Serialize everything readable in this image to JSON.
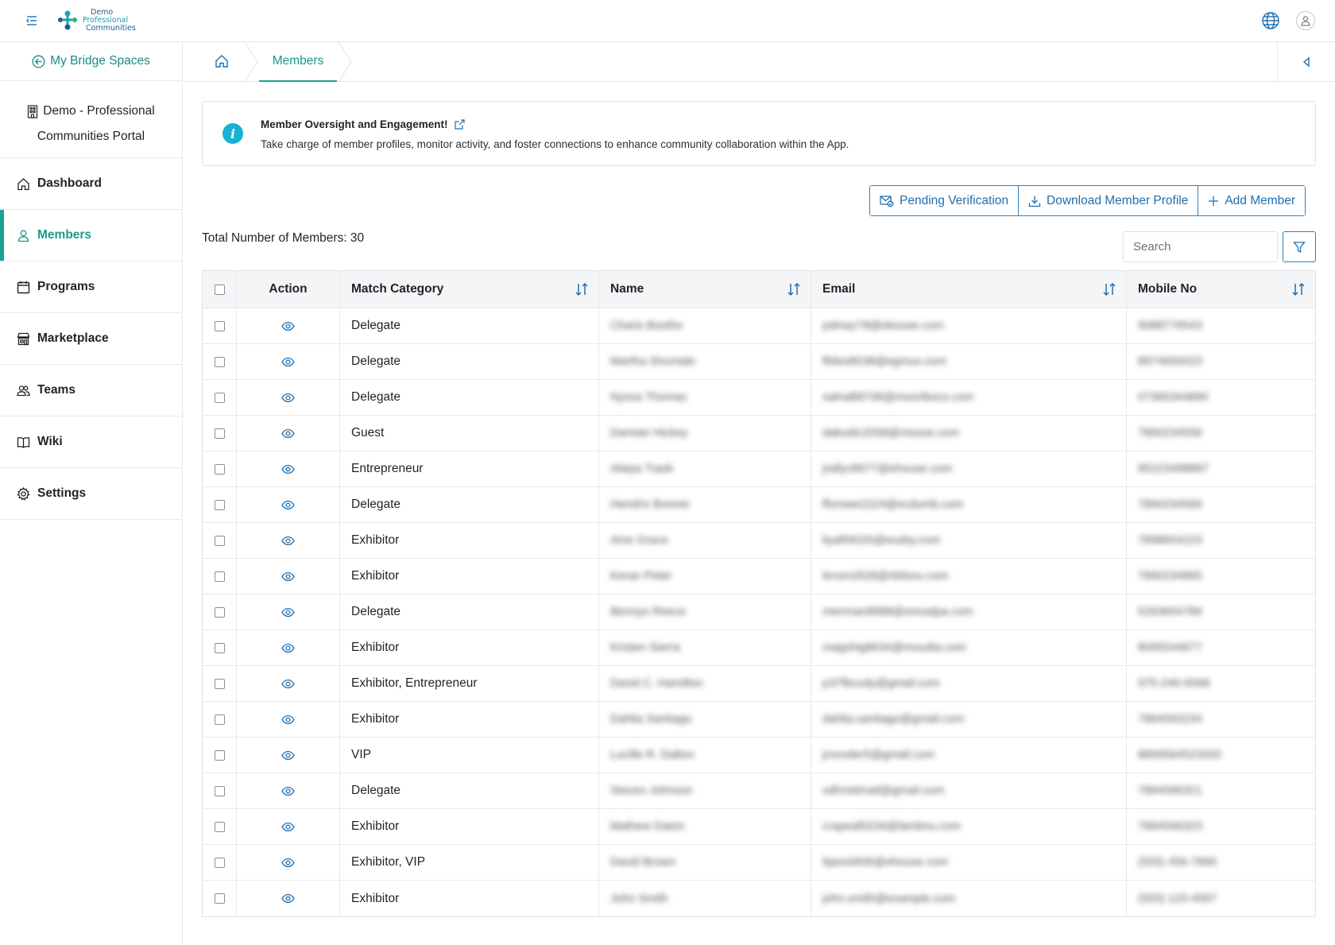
{
  "topbar": {
    "logo_lines": [
      "Demo",
      "Professional",
      "Communities"
    ]
  },
  "sidebar": {
    "back_link": "My Bridge Spaces",
    "portal_line1": "Demo - Professional",
    "portal_line2": "Communities Portal",
    "items": [
      {
        "label": "Dashboard",
        "icon": "home-icon",
        "active": false
      },
      {
        "label": "Members",
        "icon": "user-icon",
        "active": true
      },
      {
        "label": "Programs",
        "icon": "calendar-icon",
        "active": false
      },
      {
        "label": "Marketplace",
        "icon": "store-icon",
        "active": false
      },
      {
        "label": "Teams",
        "icon": "users-icon",
        "active": false
      },
      {
        "label": "Wiki",
        "icon": "book-icon",
        "active": false
      },
      {
        "label": "Settings",
        "icon": "gear-icon",
        "active": false
      }
    ]
  },
  "breadcrumb": {
    "current": "Members"
  },
  "info": {
    "title": "Member Oversight and Engagement!",
    "description": "Take charge of member profiles, monitor activity, and foster connections to enhance community collaboration within the App."
  },
  "actions": {
    "pending": "Pending Verification",
    "download": "Download Member Profile",
    "add": "Add Member"
  },
  "summary": {
    "total_label": "Total Number of Members: 30"
  },
  "search": {
    "placeholder": "Search"
  },
  "table": {
    "columns": [
      "Action",
      "Match Category",
      "Name",
      "Email",
      "Mobile No"
    ],
    "rows": [
      {
        "category": "Delegate",
        "name": "Charis Bostho",
        "email": "pdmaz78@ekouse.com",
        "mobile": "9088776543"
      },
      {
        "category": "Delegate",
        "name": "Martha Shumate",
        "email": "fblies8038@egmus.com",
        "mobile": "8974650023"
      },
      {
        "category": "Delegate",
        "name": "Nyssa Thomas",
        "email": "salnaB8706@moortbocs.com",
        "mobile": "07365344890"
      },
      {
        "category": "Guest",
        "name": "Damian Hickey",
        "email": "dakodic2058@mouse.com",
        "mobile": "7890234556"
      },
      {
        "category": "Entrepreneur",
        "name": "Alaiya Trask",
        "email": "jrallyc8677@ehouse.com",
        "mobile": "85223498887"
      },
      {
        "category": "Delegate",
        "name": "Hendrix Bonner",
        "email": "fforowe2224@ecdumb.com",
        "mobile": "7890234566"
      },
      {
        "category": "Exhibitor",
        "name": "Aine Grace",
        "email": "liyaR6020@eusby.com",
        "mobile": "7898654223"
      },
      {
        "category": "Exhibitor",
        "name": "Keran Peter",
        "email": "lerom2628@ritdsou.com",
        "mobile": "7890234865"
      },
      {
        "category": "Delegate",
        "name": "Bennyo Reece",
        "email": "memnan8988@smoalpa.com",
        "mobile": "5263654789"
      },
      {
        "category": "Exhibitor",
        "name": "Kristen Sierra",
        "email": "magshig8634@moudia.com",
        "mobile": "8095544677"
      },
      {
        "category": "Exhibitor, Entrepreneur",
        "name": "David C. Hamilton",
        "email": "p37fbcudy@gmail.com",
        "mobile": "975-249-6568"
      },
      {
        "category": "Exhibitor",
        "name": "Dahlia Santiago",
        "email": "dahlia.santiago@gmail.com",
        "mobile": "7894563234"
      },
      {
        "category": "VIP",
        "name": "Lucille R. Dalton",
        "email": "jrovoder5@gmail.com",
        "mobile": "8899564523333"
      },
      {
        "category": "Delegate",
        "name": "Steven Johnson",
        "email": "sdhnstimail@gmail.com",
        "mobile": "7894566321"
      },
      {
        "category": "Exhibitor",
        "name": "Mathew Daton",
        "email": "crapeaf0234@lambnu.com",
        "mobile": "7894566323"
      },
      {
        "category": "Exhibitor, VIP",
        "name": "David Brown",
        "email": "bjared406@ehouse.com",
        "mobile": "(555) 456-7890"
      },
      {
        "category": "Exhibitor",
        "name": "John Smith",
        "email": "john.smith@example.com",
        "mobile": "(555) 123-4567"
      }
    ]
  },
  "colors": {
    "accent": "#1aa391",
    "primary": "#1f6fb0",
    "info": "#15b2d6"
  }
}
